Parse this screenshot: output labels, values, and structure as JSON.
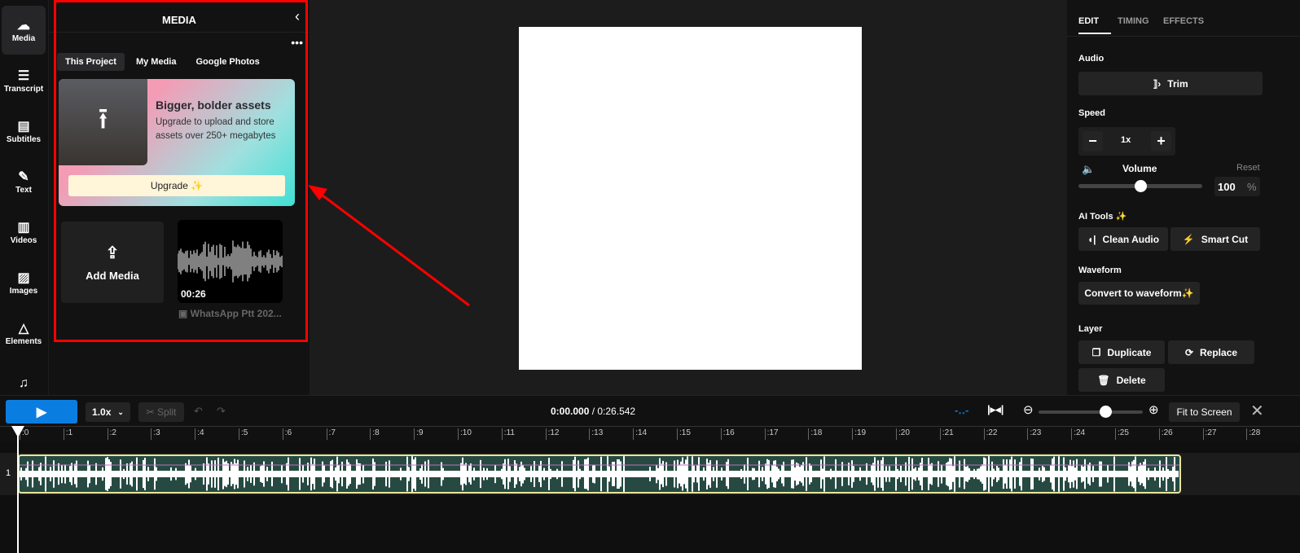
{
  "nav": [
    {
      "label": "Media",
      "icon": "☁"
    },
    {
      "label": "Transcript",
      "icon": "☰"
    },
    {
      "label": "Subtitles",
      "icon": "▤"
    },
    {
      "label": "Text",
      "icon": "✎"
    },
    {
      "label": "Videos",
      "icon": "▥"
    },
    {
      "label": "Images",
      "icon": "▨"
    },
    {
      "label": "Elements",
      "icon": "△"
    },
    {
      "label": "",
      "icon": "♫"
    }
  ],
  "media": {
    "title": "MEDIA",
    "tabs": [
      "This Project",
      "My Media",
      "Google Photos"
    ],
    "promo_title": "Bigger, bolder assets",
    "promo_text": "Upgrade to upload and store assets over 250+ megabytes",
    "upgrade": "Upgrade ✨",
    "add_media": "Add Media",
    "file_duration": "00:26",
    "file_name": "WhatsApp Ptt 202..."
  },
  "props": {
    "tabs": [
      "EDIT",
      "TIMING",
      "EFFECTS"
    ],
    "audio": "Audio",
    "trim": "Trim",
    "speed": "Speed",
    "speed_value": "1x",
    "volume": "Volume",
    "reset": "Reset",
    "volume_value": "100",
    "percent": "%",
    "volume_fraction": 0.5,
    "ai_tools": "AI Tools ✨",
    "clean_audio": "Clean Audio",
    "smart_cut": "Smart Cut",
    "waveform": "Waveform",
    "convert": "Convert to waveform✨",
    "layer": "Layer",
    "duplicate": "Duplicate",
    "replace": "Replace",
    "delete": "Delete"
  },
  "timeline": {
    "speed": "1.0x",
    "split": "✂ Split",
    "current": "0:00.000",
    "total": " / 0:26.542",
    "fit": "Fit to Screen",
    "track": "1",
    "ticks": [
      ":0",
      ":1",
      ":2",
      ":3",
      ":4",
      ":5",
      ":6",
      ":7",
      ":8",
      ":9",
      ":10",
      ":11",
      ":12",
      ":13",
      ":14",
      ":15",
      ":16",
      ":17",
      ":18",
      ":19",
      ":20",
      ":21",
      ":22",
      ":23",
      ":24",
      ":25",
      ":26",
      ":27",
      ":28"
    ]
  },
  "colors": {
    "accent": "#0a7ee0",
    "clip": "#264a42",
    "clip_border": "#e8e69a"
  }
}
